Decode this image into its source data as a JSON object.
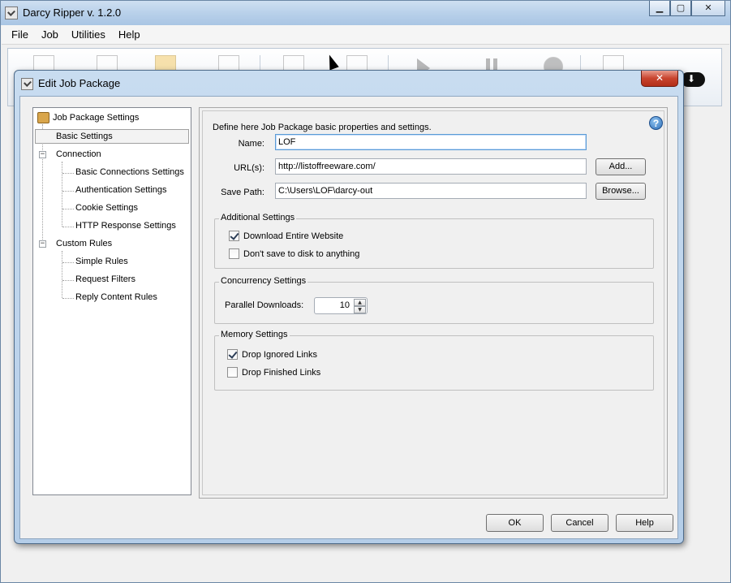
{
  "app": {
    "title": "Darcy Ripper v. 1.2.0"
  },
  "window_controls": {
    "minimize": "▁",
    "maximize": "▢",
    "close": "✕"
  },
  "menu": {
    "items": [
      "File",
      "Job",
      "Utilities",
      "Help"
    ]
  },
  "dialog": {
    "title": "Edit Job Package",
    "close_glyph": "✕",
    "tree": {
      "root": "Job Package Settings",
      "expander_minus": "−",
      "basic": "Basic Settings",
      "connection": "Connection",
      "connection_children": [
        "Basic Connections Settings",
        "Authentication Settings",
        "Cookie Settings",
        "HTTP Response Settings"
      ],
      "custom_rules": "Custom Rules",
      "custom_rules_children": [
        "Simple Rules",
        "Request Filters",
        "Reply Content Rules"
      ]
    },
    "panel": {
      "description": "Define here Job Package basic properties and settings.",
      "help_glyph": "?",
      "name_label": "Name:",
      "name_value": "LOF",
      "url_label": "URL(s):",
      "url_value": "http://listoffreeware.com/",
      "add_button": "Add...",
      "save_label": "Save Path:",
      "save_value": "C:\\Users\\LOF\\darcy-out",
      "browse_button": "Browse...",
      "additional": {
        "title": "Additional Settings",
        "download_entire": {
          "label": "Download Entire Website",
          "checked": true
        },
        "dont_save": {
          "label": "Don't save to disk to anything",
          "checked": false
        }
      },
      "concurrency": {
        "title": "Concurrency Settings",
        "parallel_label": "Parallel Downloads:",
        "parallel_value": "10",
        "up": "▲",
        "down": "▼"
      },
      "memory": {
        "title": "Memory Settings",
        "drop_ignored": {
          "label": "Drop Ignored Links",
          "checked": true
        },
        "drop_finished": {
          "label": "Drop Finished Links",
          "checked": false
        }
      }
    },
    "buttons": {
      "ok": "OK",
      "cancel": "Cancel",
      "help": "Help"
    }
  }
}
